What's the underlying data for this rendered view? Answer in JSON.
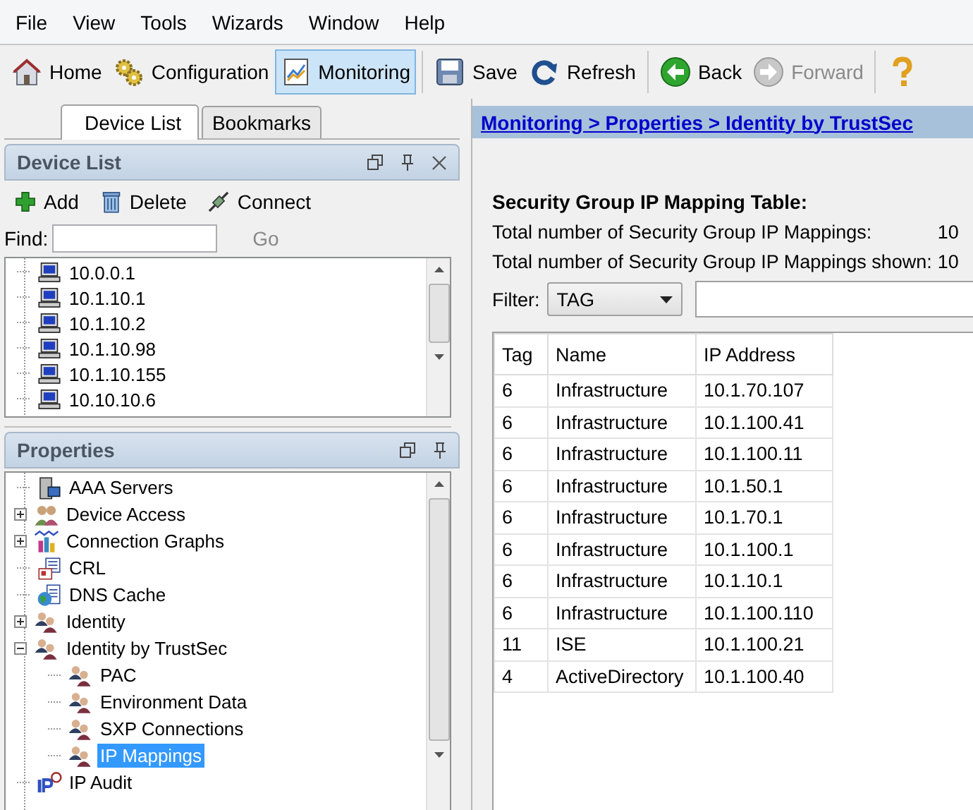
{
  "menu": [
    "File",
    "View",
    "Tools",
    "Wizards",
    "Window",
    "Help"
  ],
  "toolbar": [
    {
      "label": "Home",
      "kind": "home",
      "selected": false,
      "disabled": false
    },
    {
      "label": "Configuration",
      "kind": "config",
      "selected": false,
      "disabled": false
    },
    {
      "label": "Monitoring",
      "kind": "monitor",
      "selected": true,
      "disabled": false
    },
    {
      "label": "Save",
      "kind": "save",
      "selected": false,
      "disabled": false
    },
    {
      "label": "Refresh",
      "kind": "refresh",
      "selected": false,
      "disabled": false
    },
    {
      "label": "Back",
      "kind": "back",
      "selected": false,
      "disabled": false
    },
    {
      "label": "Forward",
      "kind": "forward",
      "selected": false,
      "disabled": true
    },
    {
      "kind": "help",
      "selected": false
    }
  ],
  "left_tabs": [
    {
      "label": "Device List",
      "selected": true
    },
    {
      "label": "Bookmarks",
      "selected": false
    }
  ],
  "device_list": {
    "title": "Device List",
    "closable": true,
    "actions": [
      {
        "label": "Add",
        "kind": "add"
      },
      {
        "label": "Delete",
        "kind": "delete"
      },
      {
        "label": "Connect",
        "kind": "connect"
      }
    ],
    "find_label": "Find:",
    "go_button": {
      "label": "Go",
      "disabled": true
    },
    "devices": [
      "10.0.0.1",
      "10.1.10.1",
      "10.1.10.2",
      "10.1.10.98",
      "10.1.10.155",
      "10.10.10.6"
    ]
  },
  "properties": {
    "title": "Properties",
    "items": [
      {
        "label": "AAA Servers",
        "kind": "server",
        "selected": false
      },
      {
        "label": "Device Access",
        "kind": "users",
        "selected": false,
        "expanded": false
      },
      {
        "label": "Connection Graphs",
        "kind": "graph",
        "selected": false,
        "expanded": false
      },
      {
        "label": "CRL",
        "kind": "cert",
        "selected": false
      },
      {
        "label": "DNS Cache",
        "kind": "dns",
        "selected": false
      },
      {
        "label": "Identity",
        "kind": "people",
        "selected": false,
        "expanded": false
      },
      {
        "label": "Identity by TrustSec",
        "kind": "people",
        "selected": false,
        "expanded": true,
        "children": [
          {
            "label": "PAC",
            "kind": "people",
            "selected": false
          },
          {
            "label": "Environment Data",
            "kind": "people",
            "selected": false
          },
          {
            "label": "SXP Connections",
            "kind": "people",
            "selected": false
          },
          {
            "label": "IP Mappings",
            "kind": "people",
            "selected": true
          }
        ]
      },
      {
        "label": "IP Audit",
        "kind": "ip",
        "selected": false
      }
    ]
  },
  "breadcrumb": "Monitoring > Properties > Identity by TrustSec",
  "mapping": {
    "title": "Security Group IP Mapping Table:",
    "stats": [
      {
        "label": "Total number of Security Group IP Mappings:",
        "value": "10"
      },
      {
        "label": "Total number of Security Group IP Mappings shown:",
        "value": "10"
      }
    ],
    "filter_label": "Filter:",
    "filter_value": "TAG",
    "columns": [
      "Tag",
      "Name",
      "IP Address"
    ],
    "rows": [
      [
        "6",
        "Infrastructure",
        "10.1.70.107"
      ],
      [
        "6",
        "Infrastructure",
        "10.1.100.41"
      ],
      [
        "6",
        "Infrastructure",
        "10.1.100.11"
      ],
      [
        "6",
        "Infrastructure",
        "10.1.50.1"
      ],
      [
        "6",
        "Infrastructure",
        "10.1.70.1"
      ],
      [
        "6",
        "Infrastructure",
        "10.1.100.1"
      ],
      [
        "6",
        "Infrastructure",
        "10.1.10.1"
      ],
      [
        "6",
        "Infrastructure",
        "10.1.100.110"
      ],
      [
        "11",
        "ISE",
        "10.1.100.21"
      ],
      [
        "4",
        "ActiveDirectory",
        "10.1.100.40"
      ]
    ]
  }
}
